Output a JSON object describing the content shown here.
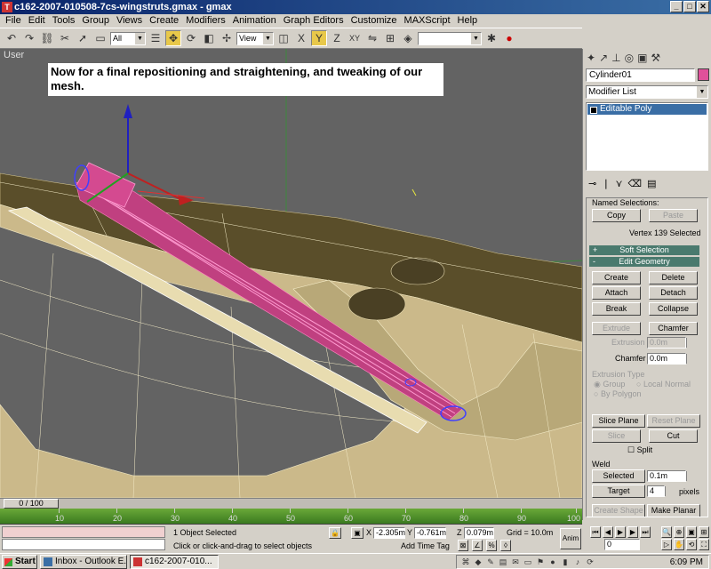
{
  "window": {
    "title": "c162-2007-010508-7cs-wingstruts.gmax - gmax",
    "app_icon": "gmax-icon",
    "controls": [
      "_",
      "□",
      "✕"
    ]
  },
  "menu": [
    "File",
    "Edit",
    "Tools",
    "Group",
    "Views",
    "Create",
    "Modifiers",
    "Animation",
    "Graph Editors",
    "Customize",
    "MAXScript",
    "Help"
  ],
  "toolbar": {
    "selection_filter": "All",
    "ref_coord": "View",
    "named_selection": ""
  },
  "viewport": {
    "label": "User",
    "note": "Now for a final repositioning and straightening, and tweaking of our mesh."
  },
  "command_panel": {
    "object_name": "Cylinder01",
    "object_color": "#e0509a",
    "modifier_list": "Modifier List",
    "stack": [
      "Editable Poly"
    ],
    "named_selections": "Named Selections:",
    "copy": "Copy",
    "paste": "Paste",
    "selection_status": "Vertex 139 Selected",
    "soft_selection": "Soft Selection",
    "edit_geometry": "Edit Geometry",
    "buttons": {
      "create": "Create",
      "delete": "Delete",
      "attach": "Attach",
      "detach": "Detach",
      "break": "Break",
      "collapse": "Collapse",
      "extrude": "Extrude",
      "chamfer": "Chamfer",
      "slice_plane": "Slice Plane",
      "reset_plane": "Reset Plane",
      "slice": "Slice",
      "cut": "Cut",
      "selected": "Selected",
      "target": "Target",
      "create_shape": "Create Shape",
      "make_planar": "Make Planar"
    },
    "extrusion_label": "Extrusion",
    "extrusion_value": "0.0m",
    "chamfer_label": "Chamfer",
    "chamfer_value": "0.0m",
    "extrusion_type": "Extrusion Type",
    "group": "Group",
    "local_normal": "Local Normal",
    "by_polygon": "By Polygon",
    "split": "Split",
    "weld": "Weld",
    "weld_value": "0.1m",
    "target_value": "4",
    "pixels": "pixels"
  },
  "timeline": {
    "slider": "0 / 100",
    "ticks": [
      "10",
      "20",
      "30",
      "40",
      "50",
      "60",
      "70",
      "80",
      "90",
      "100"
    ]
  },
  "status": {
    "selection": "1 Object Selected",
    "prompt": "Click or click-and-drag to select objects",
    "x_label": "X",
    "x": "-2.305m",
    "y_label": "Y",
    "y": "-0.761m",
    "z_label": "Z",
    "z": "0.079m",
    "grid": "Grid = 10.0m",
    "add_time_tag": "Add Time Tag",
    "anim": "Anim",
    "frame": "0"
  },
  "taskbar": {
    "start": "Start",
    "tasks": [
      "Inbox - Outlook E...",
      "c162-2007-010..."
    ],
    "clock": "6:09 PM"
  }
}
